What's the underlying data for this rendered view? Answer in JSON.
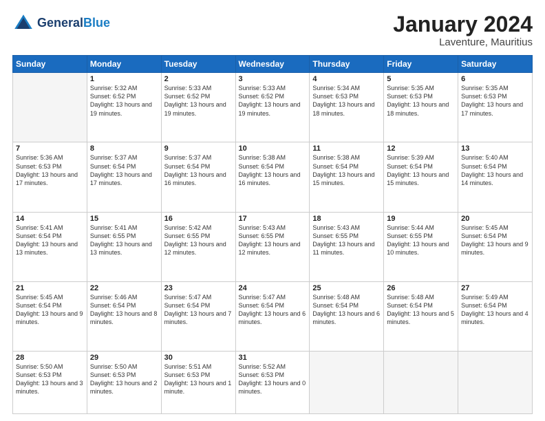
{
  "header": {
    "logo_general": "General",
    "logo_blue": "Blue",
    "month_title": "January 2024",
    "location": "Laventure, Mauritius"
  },
  "weekdays": [
    "Sunday",
    "Monday",
    "Tuesday",
    "Wednesday",
    "Thursday",
    "Friday",
    "Saturday"
  ],
  "weeks": [
    [
      {
        "day": "",
        "empty": true
      },
      {
        "day": "1",
        "sunrise": "5:32 AM",
        "sunset": "6:52 PM",
        "daylight": "13 hours and 19 minutes."
      },
      {
        "day": "2",
        "sunrise": "5:33 AM",
        "sunset": "6:52 PM",
        "daylight": "13 hours and 19 minutes."
      },
      {
        "day": "3",
        "sunrise": "5:33 AM",
        "sunset": "6:52 PM",
        "daylight": "13 hours and 19 minutes."
      },
      {
        "day": "4",
        "sunrise": "5:34 AM",
        "sunset": "6:53 PM",
        "daylight": "13 hours and 18 minutes."
      },
      {
        "day": "5",
        "sunrise": "5:35 AM",
        "sunset": "6:53 PM",
        "daylight": "13 hours and 18 minutes."
      },
      {
        "day": "6",
        "sunrise": "5:35 AM",
        "sunset": "6:53 PM",
        "daylight": "13 hours and 17 minutes."
      }
    ],
    [
      {
        "day": "7",
        "sunrise": "5:36 AM",
        "sunset": "6:53 PM",
        "daylight": "13 hours and 17 minutes."
      },
      {
        "day": "8",
        "sunrise": "5:37 AM",
        "sunset": "6:54 PM",
        "daylight": "13 hours and 17 minutes."
      },
      {
        "day": "9",
        "sunrise": "5:37 AM",
        "sunset": "6:54 PM",
        "daylight": "13 hours and 16 minutes."
      },
      {
        "day": "10",
        "sunrise": "5:38 AM",
        "sunset": "6:54 PM",
        "daylight": "13 hours and 16 minutes."
      },
      {
        "day": "11",
        "sunrise": "5:38 AM",
        "sunset": "6:54 PM",
        "daylight": "13 hours and 15 minutes."
      },
      {
        "day": "12",
        "sunrise": "5:39 AM",
        "sunset": "6:54 PM",
        "daylight": "13 hours and 15 minutes."
      },
      {
        "day": "13",
        "sunrise": "5:40 AM",
        "sunset": "6:54 PM",
        "daylight": "13 hours and 14 minutes."
      }
    ],
    [
      {
        "day": "14",
        "sunrise": "5:41 AM",
        "sunset": "6:54 PM",
        "daylight": "13 hours and 13 minutes."
      },
      {
        "day": "15",
        "sunrise": "5:41 AM",
        "sunset": "6:55 PM",
        "daylight": "13 hours and 13 minutes."
      },
      {
        "day": "16",
        "sunrise": "5:42 AM",
        "sunset": "6:55 PM",
        "daylight": "13 hours and 12 minutes."
      },
      {
        "day": "17",
        "sunrise": "5:43 AM",
        "sunset": "6:55 PM",
        "daylight": "13 hours and 12 minutes."
      },
      {
        "day": "18",
        "sunrise": "5:43 AM",
        "sunset": "6:55 PM",
        "daylight": "13 hours and 11 minutes."
      },
      {
        "day": "19",
        "sunrise": "5:44 AM",
        "sunset": "6:55 PM",
        "daylight": "13 hours and 10 minutes."
      },
      {
        "day": "20",
        "sunrise": "5:45 AM",
        "sunset": "6:54 PM",
        "daylight": "13 hours and 9 minutes."
      }
    ],
    [
      {
        "day": "21",
        "sunrise": "5:45 AM",
        "sunset": "6:54 PM",
        "daylight": "13 hours and 9 minutes."
      },
      {
        "day": "22",
        "sunrise": "5:46 AM",
        "sunset": "6:54 PM",
        "daylight": "13 hours and 8 minutes."
      },
      {
        "day": "23",
        "sunrise": "5:47 AM",
        "sunset": "6:54 PM",
        "daylight": "13 hours and 7 minutes."
      },
      {
        "day": "24",
        "sunrise": "5:47 AM",
        "sunset": "6:54 PM",
        "daylight": "13 hours and 6 minutes."
      },
      {
        "day": "25",
        "sunrise": "5:48 AM",
        "sunset": "6:54 PM",
        "daylight": "13 hours and 6 minutes."
      },
      {
        "day": "26",
        "sunrise": "5:48 AM",
        "sunset": "6:54 PM",
        "daylight": "13 hours and 5 minutes."
      },
      {
        "day": "27",
        "sunrise": "5:49 AM",
        "sunset": "6:54 PM",
        "daylight": "13 hours and 4 minutes."
      }
    ],
    [
      {
        "day": "28",
        "sunrise": "5:50 AM",
        "sunset": "6:53 PM",
        "daylight": "13 hours and 3 minutes."
      },
      {
        "day": "29",
        "sunrise": "5:50 AM",
        "sunset": "6:53 PM",
        "daylight": "13 hours and 2 minutes."
      },
      {
        "day": "30",
        "sunrise": "5:51 AM",
        "sunset": "6:53 PM",
        "daylight": "13 hours and 1 minute."
      },
      {
        "day": "31",
        "sunrise": "5:52 AM",
        "sunset": "6:53 PM",
        "daylight": "13 hours and 0 minutes."
      },
      {
        "day": "",
        "empty": true
      },
      {
        "day": "",
        "empty": true
      },
      {
        "day": "",
        "empty": true
      }
    ]
  ]
}
